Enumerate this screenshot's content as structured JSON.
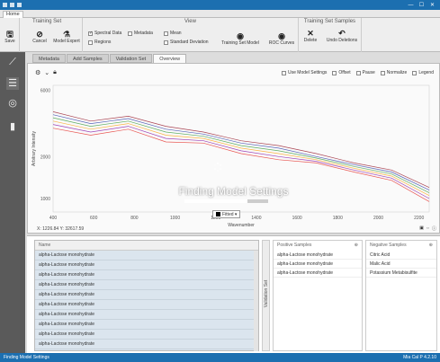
{
  "window": {
    "minimize": "—",
    "maximize": "☐",
    "close": "✕"
  },
  "menu": {
    "active": "Home"
  },
  "ribbon": {
    "save": "Save",
    "training_set_title": "Training Set",
    "cancel": "Cancel",
    "model_expert": "Model Expert",
    "view_title": "View",
    "spectral_data": "Spectral Data",
    "regions": "Regions",
    "metadata": "Metadata",
    "mean": "Mean",
    "std_dev": "Standard Deviation",
    "training_set_model": "Training Set Model",
    "roc_curves": "ROC Curves",
    "samples_title": "Training Set Samples",
    "delete": "Delete",
    "undo_deletions": "Undo Deletions"
  },
  "tabs": [
    {
      "label": "Metadata"
    },
    {
      "label": "Add Samples"
    },
    {
      "label": "Validation Set"
    },
    {
      "label": "Overview"
    }
  ],
  "plot": {
    "options": [
      "Use Model Settings",
      "Offset",
      "Pause",
      "Normalize",
      "Legend"
    ],
    "coords": "X: 1226.84  Y: 32617.59"
  },
  "busy": {
    "message": "Finding Model Settings",
    "progress": 0.75
  },
  "filter": {
    "label": "Fitted ▾"
  },
  "chart_data": {
    "type": "line",
    "xlabel": "Wavenumber",
    "ylabel": "Arbitrary Intensity",
    "xticks": [
      "400",
      "600",
      "800",
      "1000",
      "1200",
      "1400",
      "1600",
      "1800",
      "2000",
      "2200"
    ],
    "yticks": [
      "6000",
      "2000",
      "1000"
    ],
    "xlim": [
      400,
      2250
    ],
    "series": [
      {
        "color": "#9b2335",
        "values": [
          4200,
          3600,
          3900,
          3300,
          3000,
          2600,
          2400,
          2100,
          1800,
          1600,
          1200
        ]
      },
      {
        "color": "#3949ab",
        "values": [
          4000,
          3450,
          3750,
          3150,
          2900,
          2500,
          2300,
          2000,
          1750,
          1550,
          1150
        ]
      },
      {
        "color": "#43a047",
        "values": [
          3800,
          3300,
          3600,
          3000,
          2800,
          2400,
          2200,
          1950,
          1700,
          1500,
          1100
        ]
      },
      {
        "color": "#f9a825",
        "values": [
          3600,
          3150,
          3450,
          2850,
          2700,
          2300,
          2100,
          1900,
          1650,
          1450,
          1050
        ]
      },
      {
        "color": "#8e24aa",
        "values": [
          3400,
          3000,
          3300,
          2700,
          2600,
          2200,
          2000,
          1850,
          1600,
          1400,
          1000
        ]
      },
      {
        "color": "#e53935",
        "values": [
          3200,
          2850,
          3150,
          2550,
          2500,
          2100,
          1900,
          1800,
          1550,
          1350,
          950
        ]
      }
    ]
  },
  "names_table": {
    "header": "Name",
    "rows": [
      "alpha-Lactose monohydrate",
      "alpha-Lactose monohydrate",
      "alpha-Lactose monohydrate",
      "alpha-Lactose monohydrate",
      "alpha-Lactose monohydrate",
      "alpha-Lactose monohydrate",
      "alpha-Lactose monohydrate",
      "alpha-Lactose monohydrate",
      "alpha-Lactose monohydrate",
      "alpha-Lactose monohydrate"
    ]
  },
  "validation_tab": "Validation Set",
  "positive": {
    "header": "Positive Samples",
    "rows": [
      "alpha-Lactose monohydrate",
      "alpha-Lactose monohydrate",
      "alpha-Lactose monohydrate"
    ]
  },
  "negative": {
    "header": "Negative Samples",
    "rows": [
      "Citric Acid",
      "Malic Acid",
      "Potassium Metabisulfite"
    ]
  },
  "status": {
    "left": "Finding Model Settings",
    "right": "Mia Cal P 4.2.10"
  }
}
